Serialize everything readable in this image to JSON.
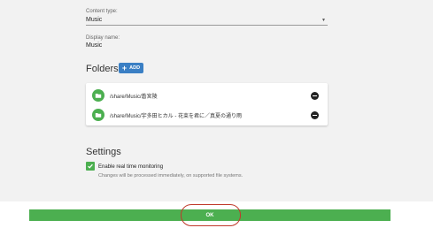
{
  "content_type": {
    "label": "Content type:",
    "value": "Music"
  },
  "display_name": {
    "label": "Display name:",
    "value": "Music"
  },
  "folders": {
    "title": "Folders",
    "add_label": "ADD",
    "items": [
      {
        "path": "/share/Music/蒼宮陵"
      },
      {
        "path": "/share/Music/宇多田ヒカル - 花束を君に／真夏の通り雨"
      }
    ]
  },
  "settings": {
    "title": "Settings",
    "realtime_label": "Enable real time monitoring",
    "realtime_checked": true,
    "realtime_hint": "Changes will be processed immediately, on supported file systems."
  },
  "footer": {
    "ok_label": "OK"
  },
  "colors": {
    "accent_green": "#4caf50",
    "accent_blue": "#3a7fc4",
    "highlight_red": "#c0392b"
  },
  "icons": [
    "folder-icon",
    "remove-circle-icon",
    "add-icon",
    "checkbox-checked-icon",
    "dropdown-caret-icon"
  ]
}
